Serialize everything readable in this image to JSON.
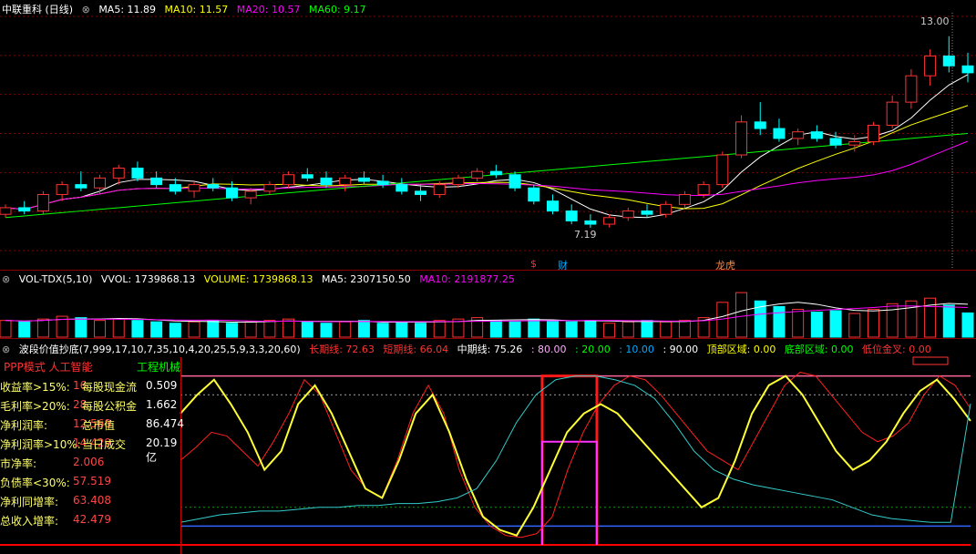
{
  "price_header": {
    "title": "中联重科 (日线)",
    "ma5": "MA5: 11.89",
    "ma10": "MA10: 11.57",
    "ma20": "MA20: 10.57",
    "ma60": "MA60: 9.17"
  },
  "vol_header": {
    "title": "VOL-TDX(5,10)",
    "vvol": "VVOL: 1739868.13",
    "volume": "VOLUME: 1739868.13",
    "ma5": "MA5: 2307150.50",
    "ma10": "MA10: 2191877.25"
  },
  "osc_header": {
    "title": "波段价值抄底(7,999,17,10,7,35,10,4,20,25,5,9,3,3,20,60)",
    "long": "长期线: 72.63",
    "short": "短期线: 66.04",
    "mid": "中期线: 75.26",
    "v80": ": 80.00",
    "v20": ": 20.00",
    "v10": ": 10.00",
    "v90": ": 90.00",
    "top": "顶部区域: 0.00",
    "bottom": "底部区域: 0.00",
    "cross": "低位金叉: 0.00"
  },
  "annotations": {
    "high": "13.00",
    "low": "7.19",
    "m1": "$",
    "m2": "财",
    "m3": "龙虎"
  },
  "colors": {
    "up": "#ff3232",
    "down": "#00ffff",
    "ma5": "#ffffff",
    "ma10": "#ffff00",
    "ma20": "#ff00ff",
    "ma60": "#00ff00",
    "grid": "#8b0000"
  },
  "info": {
    "header_left": "PPP模式 人工智能",
    "header_right": "工程机械",
    "rows": [
      {
        "label": "收益率>15%:",
        "value": "16",
        "label2": "每股现金流",
        "value2": "0.509"
      },
      {
        "label": "毛利率>20%:",
        "value": "28",
        "label2": "每股公积金",
        "value2": "1.662"
      },
      {
        "label": "净利润率:",
        "value": "12.568",
        "label2": "总市值",
        "value2": "86.474"
      },
      {
        "label": "净利润率>10%:",
        "value": "14.429",
        "label2": "当日成交",
        "value2": "20.19亿"
      },
      {
        "label": "市净率:",
        "value": "2.006",
        "label2": "",
        "value2": ""
      },
      {
        "label": "负债率<30%:",
        "value": "57.519",
        "label2": "",
        "value2": ""
      },
      {
        "label": "净利同增率:",
        "value": "63.408",
        "label2": "",
        "value2": ""
      },
      {
        "label": "总收入增率:",
        "value": "42.479",
        "label2": "",
        "value2": ""
      }
    ]
  },
  "chart_data": [
    {
      "type": "candlestick",
      "title": "中联重科 (日线)",
      "ylim": [
        6.5,
        13.6
      ],
      "series_hint": "daily OHLC approximated from image",
      "ohlc": [
        [
          7.6,
          7.9,
          7.5,
          7.8
        ],
        [
          7.8,
          8.0,
          7.6,
          7.7
        ],
        [
          7.7,
          8.3,
          7.6,
          8.2
        ],
        [
          8.2,
          8.6,
          8.0,
          8.5
        ],
        [
          8.5,
          8.9,
          8.3,
          8.4
        ],
        [
          8.4,
          8.8,
          8.2,
          8.7
        ],
        [
          8.7,
          9.1,
          8.5,
          9.0
        ],
        [
          9.0,
          9.2,
          8.6,
          8.7
        ],
        [
          8.7,
          8.9,
          8.4,
          8.5
        ],
        [
          8.5,
          8.7,
          8.2,
          8.3
        ],
        [
          8.3,
          8.6,
          8.1,
          8.5
        ],
        [
          8.5,
          8.7,
          8.3,
          8.4
        ],
        [
          8.4,
          8.6,
          8.0,
          8.1
        ],
        [
          8.1,
          8.4,
          7.9,
          8.3
        ],
        [
          8.3,
          8.6,
          8.2,
          8.5
        ],
        [
          8.5,
          8.9,
          8.4,
          8.8
        ],
        [
          8.8,
          9.0,
          8.6,
          8.7
        ],
        [
          8.7,
          8.9,
          8.4,
          8.5
        ],
        [
          8.5,
          8.8,
          8.3,
          8.7
        ],
        [
          8.7,
          8.9,
          8.5,
          8.6
        ],
        [
          8.6,
          8.8,
          8.4,
          8.5
        ],
        [
          8.5,
          8.7,
          8.2,
          8.3
        ],
        [
          8.3,
          8.5,
          8.0,
          8.2
        ],
        [
          8.2,
          8.6,
          8.1,
          8.5
        ],
        [
          8.5,
          8.8,
          8.4,
          8.7
        ],
        [
          8.7,
          9.0,
          8.6,
          8.9
        ],
        [
          8.9,
          9.1,
          8.7,
          8.8
        ],
        [
          8.8,
          8.9,
          8.3,
          8.4
        ],
        [
          8.4,
          8.5,
          7.9,
          8.0
        ],
        [
          8.0,
          8.2,
          7.6,
          7.7
        ],
        [
          7.7,
          7.9,
          7.3,
          7.4
        ],
        [
          7.4,
          7.6,
          7.19,
          7.3
        ],
        [
          7.3,
          7.6,
          7.2,
          7.5
        ],
        [
          7.5,
          7.8,
          7.4,
          7.7
        ],
        [
          7.7,
          7.9,
          7.5,
          7.6
        ],
        [
          7.6,
          8.0,
          7.5,
          7.9
        ],
        [
          7.9,
          8.3,
          7.8,
          8.2
        ],
        [
          8.2,
          8.6,
          8.1,
          8.5
        ],
        [
          8.5,
          9.5,
          8.4,
          9.4
        ],
        [
          9.4,
          10.6,
          9.3,
          10.4
        ],
        [
          10.4,
          11.0,
          10.0,
          10.2
        ],
        [
          10.2,
          10.5,
          9.8,
          9.9
        ],
        [
          9.9,
          10.2,
          9.7,
          10.1
        ],
        [
          10.1,
          10.3,
          9.8,
          9.9
        ],
        [
          9.9,
          10.1,
          9.6,
          9.7
        ],
        [
          9.7,
          10.0,
          9.5,
          9.8
        ],
        [
          9.8,
          10.4,
          9.7,
          10.3
        ],
        [
          10.3,
          11.2,
          10.2,
          11.0
        ],
        [
          11.0,
          12.0,
          10.8,
          11.8
        ],
        [
          11.8,
          12.6,
          11.5,
          12.4
        ],
        [
          12.4,
          13.0,
          11.9,
          12.1
        ],
        [
          12.1,
          12.5,
          11.6,
          11.89
        ]
      ]
    },
    {
      "type": "bar",
      "title": "VOL-TDX(5,10)",
      "values": [
        1.2,
        1.1,
        1.3,
        1.5,
        1.4,
        1.2,
        1.3,
        1.2,
        1.1,
        1.0,
        1.1,
        1.2,
        1.0,
        1.1,
        1.2,
        1.3,
        1.1,
        1.0,
        1.1,
        1.2,
        1.0,
        1.1,
        1.0,
        1.2,
        1.3,
        1.4,
        1.2,
        1.1,
        1.3,
        1.2,
        1.1,
        1.2,
        1.0,
        1.1,
        1.2,
        1.1,
        1.2,
        1.4,
        2.5,
        3.2,
        2.6,
        2.2,
        2.0,
        1.8,
        1.9,
        1.7,
        2.0,
        2.4,
        2.6,
        2.8,
        2.3,
        1.74
      ]
    },
    {
      "type": "line",
      "title": "波段价值抄底",
      "ylim": [
        0,
        100
      ],
      "series": [
        {
          "name": "长期线",
          "values": [
            45,
            52,
            60,
            58,
            50,
            42,
            55,
            70,
            88,
            80,
            60,
            40,
            30,
            25,
            45,
            70,
            85,
            70,
            40,
            20,
            10,
            5,
            4,
            6,
            15,
            40,
            60,
            75,
            85,
            90,
            88,
            80,
            70,
            60,
            50,
            45,
            40,
            55,
            70,
            85,
            92,
            90,
            80,
            70,
            60,
            55,
            58,
            65,
            80,
            90,
            85,
            72.63
          ]
        },
        {
          "name": "短期线",
          "values": [
            70,
            80,
            88,
            75,
            60,
            40,
            50,
            75,
            85,
            70,
            50,
            30,
            25,
            45,
            70,
            80,
            60,
            35,
            15,
            8,
            5,
            20,
            40,
            60,
            70,
            75,
            70,
            60,
            50,
            40,
            30,
            20,
            25,
            45,
            70,
            85,
            90,
            80,
            65,
            50,
            40,
            45,
            55,
            70,
            82,
            88,
            78,
            66.04
          ]
        },
        {
          "name": "中期线",
          "values": [
            12,
            14,
            16,
            17,
            18,
            18,
            19,
            20,
            20,
            21,
            21,
            22,
            22,
            23,
            25,
            30,
            45,
            65,
            80,
            88,
            90,
            90,
            88,
            85,
            78,
            65,
            50,
            40,
            35,
            32,
            30,
            28,
            26,
            24,
            20,
            16,
            14,
            13,
            12,
            12,
            75.26
          ]
        }
      ]
    }
  ]
}
